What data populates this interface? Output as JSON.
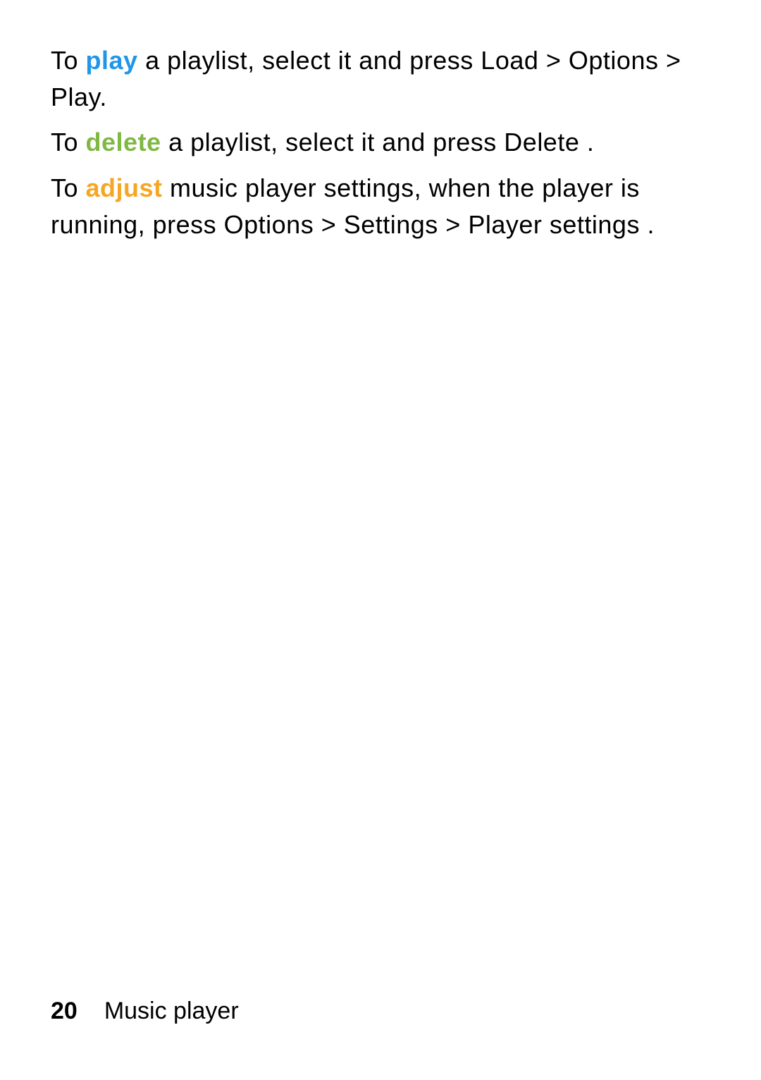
{
  "paragraphs": {
    "p1": {
      "t1": "To ",
      "kw": "play",
      "t2": " a playlist, select it and press Load > Options > Play."
    },
    "p2": {
      "t1": "To ",
      "kw": "delete",
      "t2": " a playlist, select it and press Delete ."
    },
    "p3": {
      "t1": "To ",
      "kw": "adjust",
      "t2": " music player settings, when the player is running, press Options  > Settings  > Player settings  ."
    }
  },
  "footer": {
    "page_number": "20",
    "section": "Music player"
  }
}
